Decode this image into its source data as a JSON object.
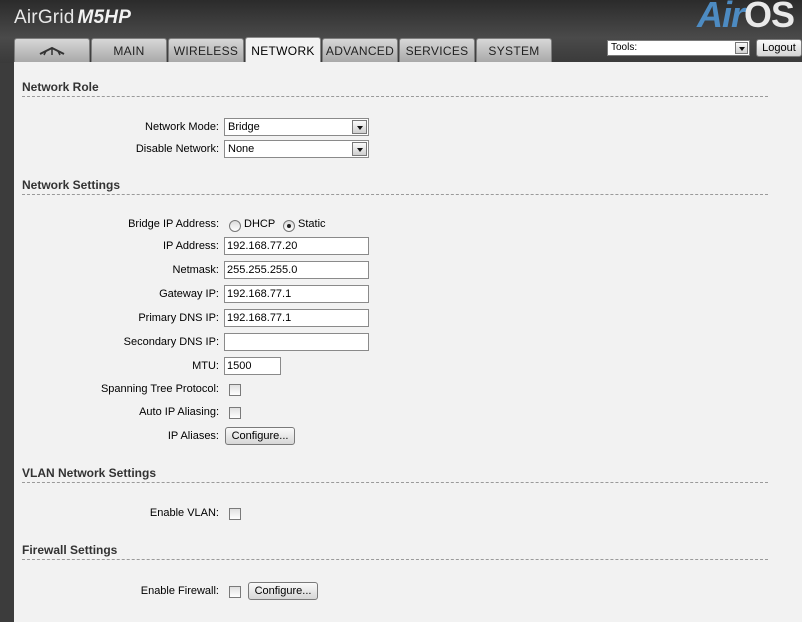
{
  "header": {
    "brand": "AirGrid",
    "model": "M5HP",
    "logo_part1": "Air",
    "logo_part2": "OS"
  },
  "tabs": [
    {
      "label": "",
      "icon": "ubiquiti-logo-icon"
    },
    {
      "label": "MAIN"
    },
    {
      "label": "WIRELESS"
    },
    {
      "label": "NETWORK",
      "active": true
    },
    {
      "label": "ADVANCED"
    },
    {
      "label": "SERVICES"
    },
    {
      "label": "SYSTEM"
    }
  ],
  "tools": {
    "value": "Tools:"
  },
  "logout_label": "Logout",
  "sections": {
    "network_role": "Network Role",
    "network_settings": "Network Settings",
    "vlan": "VLAN Network Settings",
    "firewall": "Firewall Settings"
  },
  "role": {
    "network_mode_label": "Network Mode:",
    "network_mode_value": "Bridge",
    "disable_network_label": "Disable Network:",
    "disable_network_value": "None"
  },
  "settings": {
    "bridge_ip_label": "Bridge IP Address:",
    "dhcp_label": "DHCP",
    "static_label": "Static",
    "ip_label": "IP Address:",
    "ip_value": "192.168.77.20",
    "netmask_label": "Netmask:",
    "netmask_value": "255.255.255.0",
    "gateway_label": "Gateway IP:",
    "gateway_value": "192.168.77.1",
    "dns1_label": "Primary DNS IP:",
    "dns1_value": "192.168.77.1",
    "dns2_label": "Secondary DNS IP:",
    "dns2_value": "",
    "mtu_label": "MTU:",
    "mtu_value": "1500",
    "stp_label": "Spanning Tree Protocol:",
    "auto_alias_label": "Auto IP Aliasing:",
    "ip_aliases_label": "IP Aliases:",
    "configure_label": "Configure..."
  },
  "vlan": {
    "enable_label": "Enable VLAN:"
  },
  "firewall": {
    "enable_label": "Enable Firewall:",
    "configure_label": "Configure..."
  }
}
